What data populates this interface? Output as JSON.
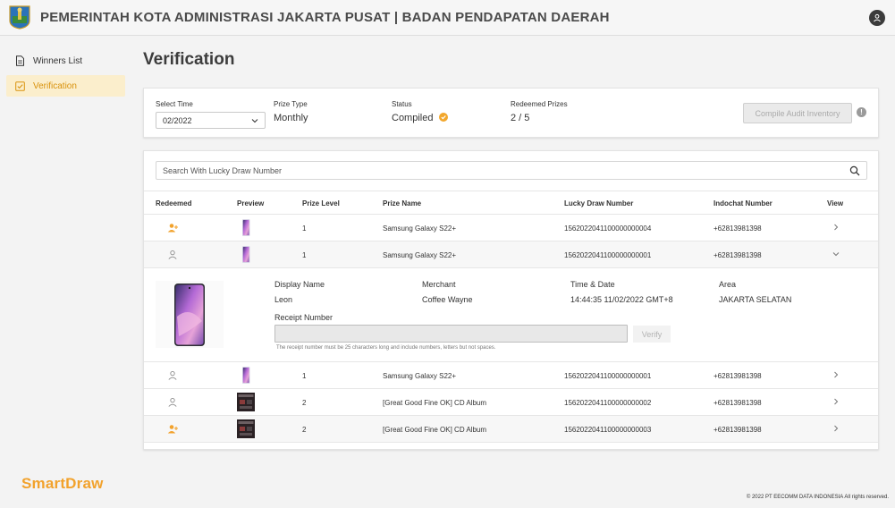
{
  "header": {
    "title": "PEMERINTAH KOTA ADMINISTRASI JAKARTA PUSAT | BADAN PENDAPATAN DAERAH"
  },
  "sidebar": {
    "items": [
      {
        "label": "Winners List",
        "icon": "document-icon"
      },
      {
        "label": "Verification",
        "icon": "checkbox-icon"
      }
    ],
    "brand": "SmartDraw"
  },
  "page": {
    "title": "Verification"
  },
  "summary": {
    "select_time": {
      "label": "Select Time",
      "value": "02/2022"
    },
    "prize_type": {
      "label": "Prize Type",
      "value": "Monthly"
    },
    "status": {
      "label": "Status",
      "value": "Compiled"
    },
    "redeemed": {
      "label": "Redeemed Prizes",
      "value": "2 / 5"
    },
    "compile_button": "Compile Audit Inventory"
  },
  "search": {
    "placeholder": "Search With Lucky Draw Number"
  },
  "table": {
    "headers": [
      "Redeemed",
      "Preview",
      "Prize Level",
      "Prize Name",
      "Lucky Draw Number",
      "Indochat Number",
      "View"
    ],
    "rows": [
      {
        "redeemed": true,
        "preview": "phone",
        "level": "1",
        "prize": "Samsung Galaxy S22+",
        "lucky": "1562022041100000000004",
        "indochat": "+62813981398"
      },
      {
        "redeemed": false,
        "preview": "phone",
        "level": "1",
        "prize": "Samsung Galaxy S22+",
        "lucky": "1562022041100000000001",
        "indochat": "+62813981398"
      },
      {
        "redeemed": false,
        "preview": "phone",
        "level": "1",
        "prize": "Samsung Galaxy S22+",
        "lucky": "1562022041100000000001",
        "indochat": "+62813981398"
      },
      {
        "redeemed": false,
        "preview": "album",
        "level": "2",
        "prize": "[Great Good Fine OK] CD Album",
        "lucky": "1562022041100000000002",
        "indochat": "+62813981398"
      },
      {
        "redeemed": true,
        "preview": "album",
        "level": "2",
        "prize": "[Great Good Fine OK] CD Album",
        "lucky": "1562022041100000000003",
        "indochat": "+62813981398"
      }
    ]
  },
  "detail": {
    "display_name_label": "Display Name",
    "display_name": "Leon",
    "merchant_label": "Merchant",
    "merchant": "Coffee Wayne",
    "time_label": "Time & Date",
    "time": "14:44:35 11/02/2022 GMT+8",
    "area_label": "Area",
    "area": "JAKARTA SELATAN",
    "receipt_label": "Receipt Number",
    "verify_button": "Verify",
    "hint": "The receipt number must be 25 characters long and include numbers, letters but not spaces."
  },
  "footer": "© 2022 PT EECOMM DATA INDONESIA All rights reserved.",
  "colors": {
    "accent": "#f2a22c",
    "active_bg": "#fbeecc",
    "text": "#333333"
  }
}
